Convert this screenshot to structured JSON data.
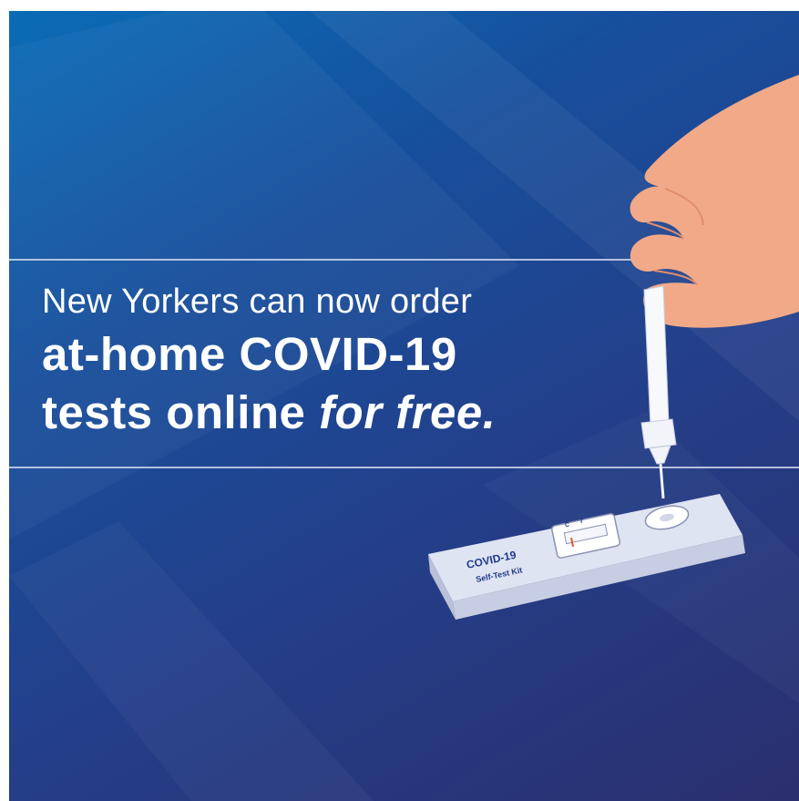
{
  "headline": {
    "line1": "New Yorkers can now order",
    "line2": "at-home COVID-19",
    "line3_plain": "tests online ",
    "line3_emphasis": "for free."
  },
  "kit": {
    "name": "COVID-19",
    "subtitle": "Self-Test Kit",
    "control_mark": "C",
    "test_mark": "T"
  },
  "colors": {
    "background_top": "#0a6cb6",
    "background_bottom": "#2a2f6e",
    "skin": "#f2a987",
    "kit_label": "#1e3a8a",
    "result_line": "#e05a2a"
  },
  "icons": [
    "hand-icon",
    "swab-tube-icon",
    "test-cassette-icon"
  ]
}
